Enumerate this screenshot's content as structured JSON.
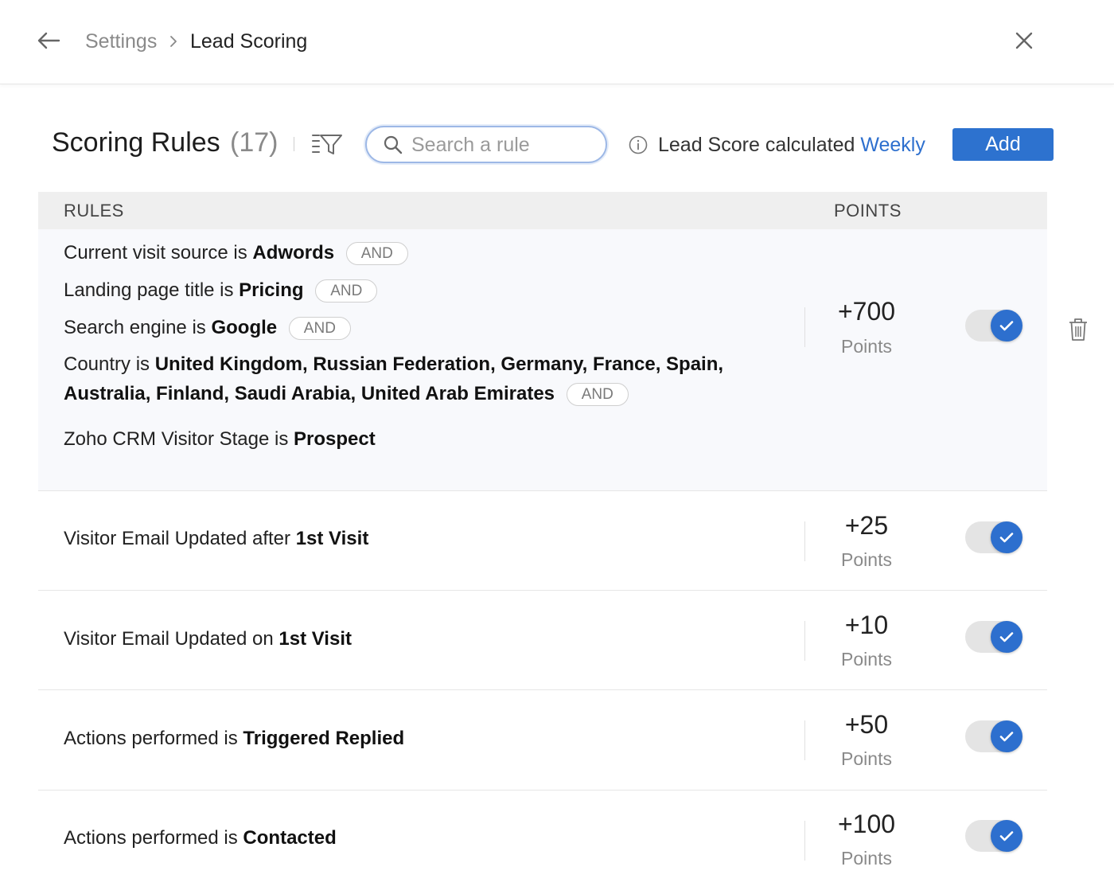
{
  "header": {
    "back_icon": "arrow-left-icon",
    "breadcrumb": {
      "parent": "Settings",
      "separator_icon": "chevron-right-icon",
      "current": "Lead Scoring"
    },
    "close_icon": "close-icon"
  },
  "toolbar": {
    "title": "Scoring Rules",
    "count": "(17)",
    "filter_icon": "filter-sort-icon",
    "search": {
      "placeholder": "Search a rule",
      "value": ""
    },
    "calc_prefix": "Lead Score calculated",
    "calc_frequency": "Weekly",
    "add_label": "Add"
  },
  "table": {
    "col_rules": "RULES",
    "col_points": "POINTS",
    "rows": [
      {
        "conditions": [
          {
            "prefix": "Current visit source is ",
            "value": "Adwords",
            "chip": "AND"
          },
          {
            "prefix": "Landing page title is ",
            "value": "Pricing",
            "chip": "AND"
          },
          {
            "prefix": "Search engine is ",
            "value": "Google",
            "chip": "AND"
          },
          {
            "prefix": "Country is ",
            "value": "United Kingdom, Russian Federation, Germany, France, Spain,",
            "value2": "Australia, Finland, Saudi Arabia, United Arab Emirates",
            "chip": "AND"
          },
          {
            "prefix": "Zoho CRM Visitor Stage is ",
            "value": "Prospect"
          }
        ],
        "points": "+700",
        "points_label": "Points",
        "enabled": true
      },
      {
        "conditions": [
          {
            "prefix": "Visitor Email Updated after ",
            "value": "1st Visit"
          }
        ],
        "points": "+25",
        "points_label": "Points",
        "enabled": true
      },
      {
        "conditions": [
          {
            "prefix": "Visitor Email Updated on ",
            "value": "1st Visit"
          }
        ],
        "points": "+10",
        "points_label": "Points",
        "enabled": true
      },
      {
        "conditions": [
          {
            "prefix": "Actions performed is ",
            "value": "Triggered Replied"
          }
        ],
        "points": "+50",
        "points_label": "Points",
        "enabled": true
      },
      {
        "conditions": [
          {
            "prefix": "Actions performed is ",
            "value": "Contacted"
          }
        ],
        "points": "+100",
        "points_label": "Points",
        "enabled": true
      }
    ]
  },
  "row_actions": {
    "delete_icon": "trash-icon"
  },
  "colors": {
    "accent": "#2d72cf",
    "link": "#2d6fce",
    "toggle_track": "#e4e4e4"
  }
}
